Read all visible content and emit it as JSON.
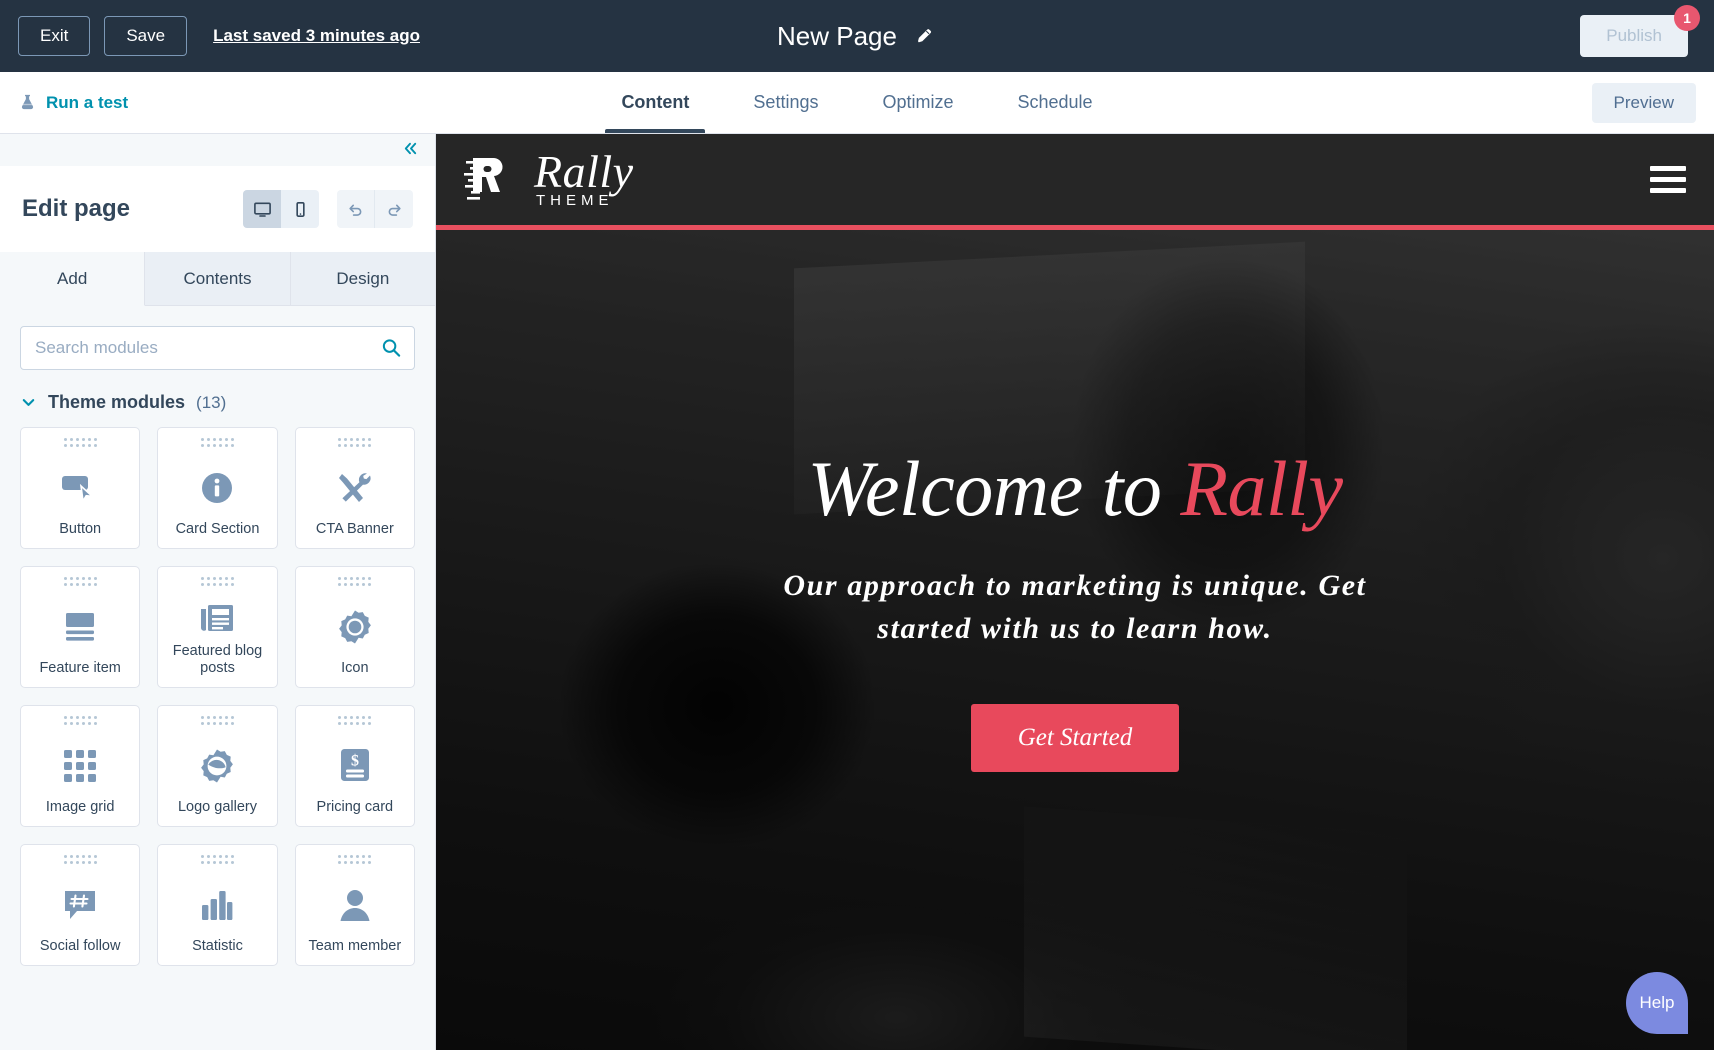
{
  "topbar": {
    "exit_label": "Exit",
    "save_label": "Save",
    "saved_status": "Last saved 3 minutes ago",
    "page_title": "New Page",
    "edit_title_icon": "pencil-icon",
    "publish_label": "Publish",
    "publish_badge": "1",
    "bg_color": "#253342"
  },
  "navbar": {
    "run_test_label": "Run a test",
    "run_test_icon": "flask-icon",
    "accent_color": "#0091ae",
    "tabs": [
      {
        "label": "Content",
        "active": true
      },
      {
        "label": "Settings",
        "active": false
      },
      {
        "label": "Optimize",
        "active": false
      },
      {
        "label": "Schedule",
        "active": false
      }
    ],
    "preview_label": "Preview"
  },
  "sidebar": {
    "collapse_icon": "chevron-double-left-icon",
    "edit_title": "Edit page",
    "device_toggle": [
      {
        "icon": "desktop-icon",
        "active": true
      },
      {
        "icon": "mobile-icon",
        "active": false
      }
    ],
    "history": [
      {
        "icon": "undo-icon"
      },
      {
        "icon": "redo-icon"
      }
    ],
    "panel_tabs": [
      {
        "label": "Add",
        "active": true
      },
      {
        "label": "Contents",
        "active": false
      },
      {
        "label": "Design",
        "active": false
      }
    ],
    "search": {
      "placeholder": "Search modules",
      "value": "",
      "icon": "search-icon"
    },
    "group": {
      "name": "Theme modules",
      "count": "(13)",
      "expanded": true,
      "chevron_icon": "chevron-down-icon"
    },
    "modules": [
      {
        "label": "Button",
        "icon": "button-click-icon"
      },
      {
        "label": "Card Section",
        "icon": "info-circle-icon"
      },
      {
        "label": "CTA Banner",
        "icon": "tools-icon"
      },
      {
        "label": "Feature item",
        "icon": "image-text-icon"
      },
      {
        "label": "Featured blog posts",
        "icon": "newspaper-icon"
      },
      {
        "label": "Icon",
        "icon": "badge-circle-icon"
      },
      {
        "label": "Image grid",
        "icon": "grid-dots-icon"
      },
      {
        "label": "Logo gallery",
        "icon": "badge-swoosh-icon"
      },
      {
        "label": "Pricing card",
        "icon": "price-tag-icon"
      },
      {
        "label": "Social follow",
        "icon": "hashtag-bubble-icon"
      },
      {
        "label": "Statistic",
        "icon": "bar-chart-icon"
      },
      {
        "label": "Team member",
        "icon": "person-icon"
      }
    ]
  },
  "preview": {
    "site_header": {
      "logo_icon": "rally-r-motion-icon",
      "logo_name": "Rally",
      "logo_tagline": "THEME",
      "menu_icon": "hamburger-icon",
      "bg_color": "#262626",
      "accent_border_color": "#e8505f"
    },
    "hero": {
      "heading_plain": "Welcome to ",
      "heading_accent": "Rally",
      "subheading": "Our approach to marketing is unique. Get started with us to learn how.",
      "cta_label": "Get Started",
      "cta_color": "#e8495c"
    },
    "help_label": "Help",
    "help_color": "#7c8ae0"
  }
}
